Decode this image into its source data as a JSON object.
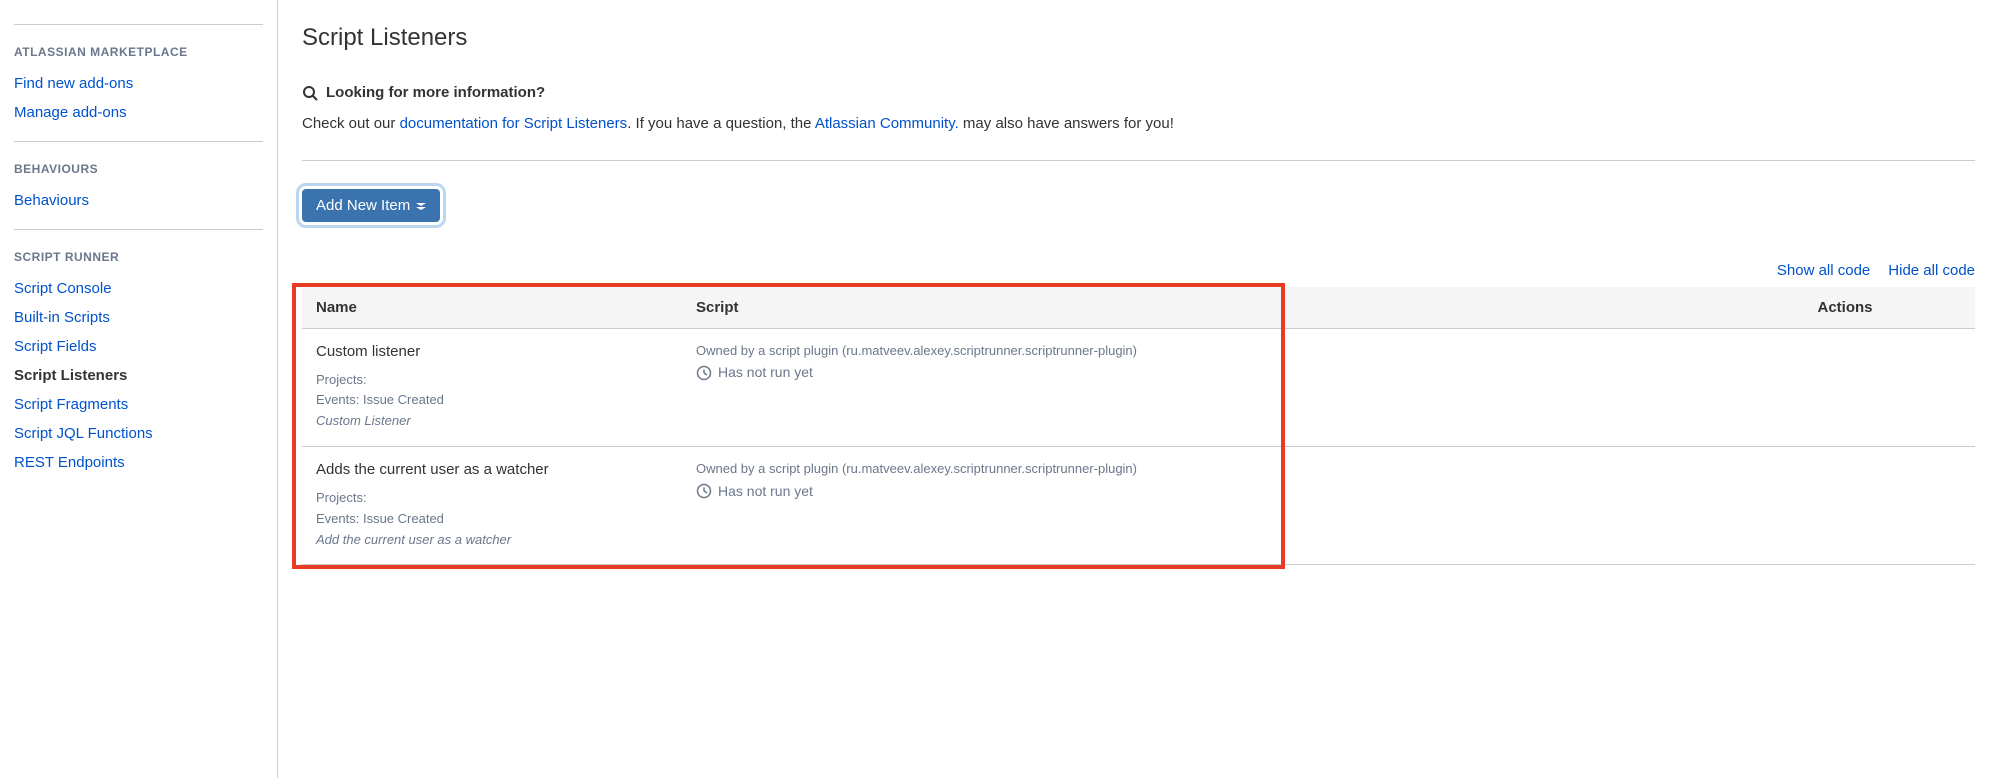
{
  "sidebar": {
    "sections": [
      {
        "heading": "ATLASSIAN MARKETPLACE",
        "items": [
          {
            "label": "Find new add-ons",
            "name": "sidebar-find-new-addons"
          },
          {
            "label": "Manage add-ons",
            "name": "sidebar-manage-addons"
          }
        ]
      },
      {
        "heading": "BEHAVIOURS",
        "items": [
          {
            "label": "Behaviours",
            "name": "sidebar-behaviours"
          }
        ]
      },
      {
        "heading": "SCRIPT RUNNER",
        "items": [
          {
            "label": "Script Console",
            "name": "sidebar-script-console"
          },
          {
            "label": "Built-in Scripts",
            "name": "sidebar-builtin-scripts"
          },
          {
            "label": "Script Fields",
            "name": "sidebar-script-fields"
          },
          {
            "label": "Script Listeners",
            "name": "sidebar-script-listeners",
            "active": true
          },
          {
            "label": "Script Fragments",
            "name": "sidebar-script-fragments"
          },
          {
            "label": "Script JQL Functions",
            "name": "sidebar-script-jql-functions"
          },
          {
            "label": "REST Endpoints",
            "name": "sidebar-rest-endpoints"
          }
        ]
      }
    ]
  },
  "page": {
    "title": "Script Listeners",
    "info_title": "Looking for more information?",
    "info_prefix": "Check out our ",
    "info_link1": "documentation for Script Listeners",
    "info_mid": ". If you have a question, the ",
    "info_link2": "Atlassian Community.",
    "info_suffix": " may also have answers for you!",
    "add_button": "Add New Item",
    "show_all": "Show all code",
    "hide_all": "Hide all code"
  },
  "table": {
    "columns": {
      "name": "Name",
      "script": "Script",
      "actions": "Actions"
    },
    "rows": [
      {
        "title": "Custom listener",
        "projects_label": "Projects:",
        "events_label": "Events: Issue Created",
        "listener_type": "Custom Listener",
        "owned": "Owned by a script plugin (ru.matveev.alexey.scriptrunner.scriptrunner-plugin)",
        "status": "Has not run yet"
      },
      {
        "title": "Adds the current user as a watcher",
        "projects_label": "Projects:",
        "events_label": "Events: Issue Created",
        "listener_type": "Add the current user as a watcher",
        "owned": "Owned by a script plugin (ru.matveev.alexey.scriptrunner.scriptrunner-plugin)",
        "status": "Has not run yet"
      }
    ]
  }
}
